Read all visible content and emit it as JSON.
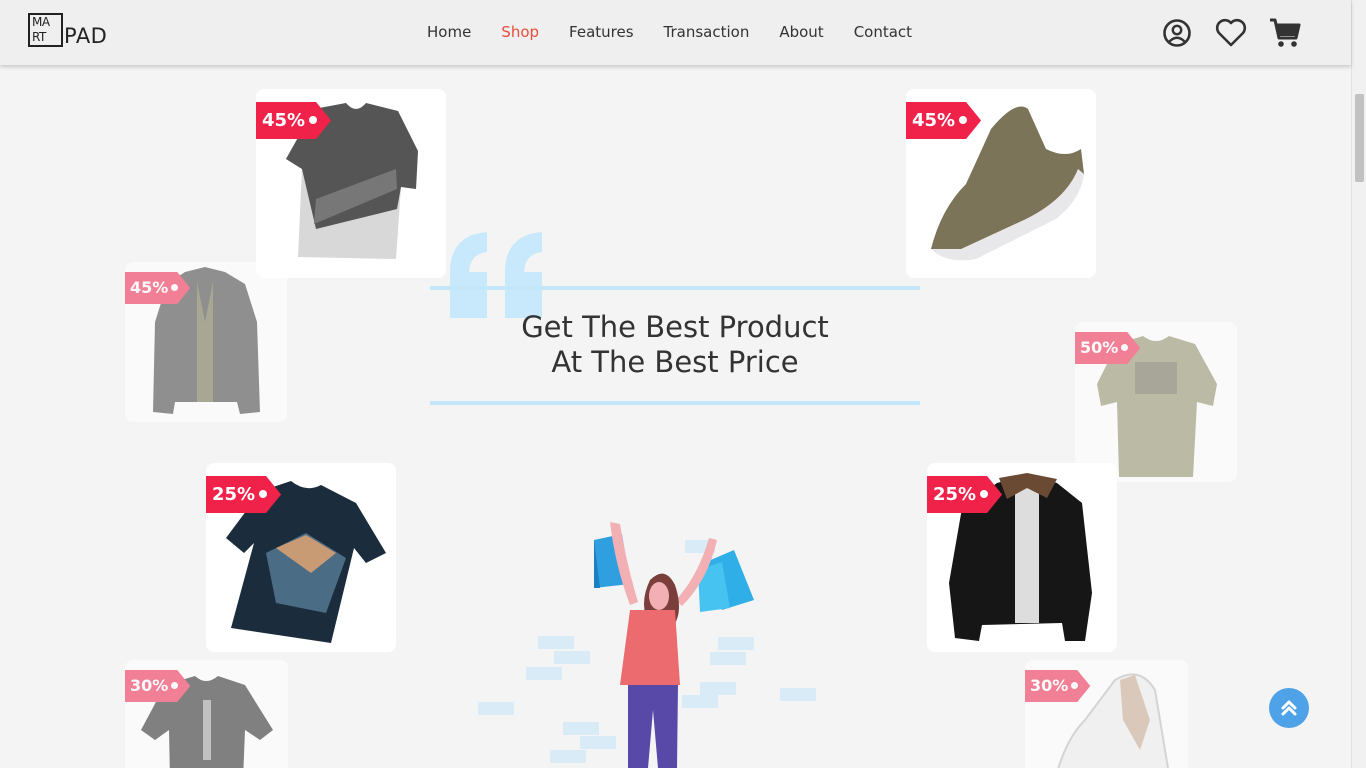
{
  "brand": {
    "logo_top": "MA",
    "logo_bottom": "RT",
    "logo_pad": "PAD"
  },
  "nav": {
    "items": [
      {
        "label": "Home"
      },
      {
        "label": "Shop"
      },
      {
        "label": "Features"
      },
      {
        "label": "Transaction"
      },
      {
        "label": "About"
      },
      {
        "label": "Contact"
      }
    ],
    "active": "Shop"
  },
  "header_icons": [
    "user-circle-icon",
    "heart-icon",
    "cart-icon"
  ],
  "hero": {
    "line1": "Get The Best Product",
    "line2": "At The Best Price"
  },
  "products": [
    {
      "discount": "45%",
      "item": "gray t-shirt"
    },
    {
      "discount": "45%",
      "item": "olive sneaker"
    },
    {
      "discount": "45%",
      "item": "gray jacket"
    },
    {
      "discount": "50%",
      "item": "khaki t-shirt"
    },
    {
      "discount": "25%",
      "item": "navy print t-shirt"
    },
    {
      "discount": "25%",
      "item": "black puffer jacket"
    },
    {
      "discount": "30%",
      "item": "gray graphic t-shirt"
    },
    {
      "discount": "30%",
      "item": "white sneaker"
    }
  ],
  "colors": {
    "accent": "#e74c3c",
    "tag": "#f0224a",
    "line": "#c3e6f8",
    "top_button": "#4da2e8"
  },
  "scroll_top_icon": "double-chevron-up-icon"
}
